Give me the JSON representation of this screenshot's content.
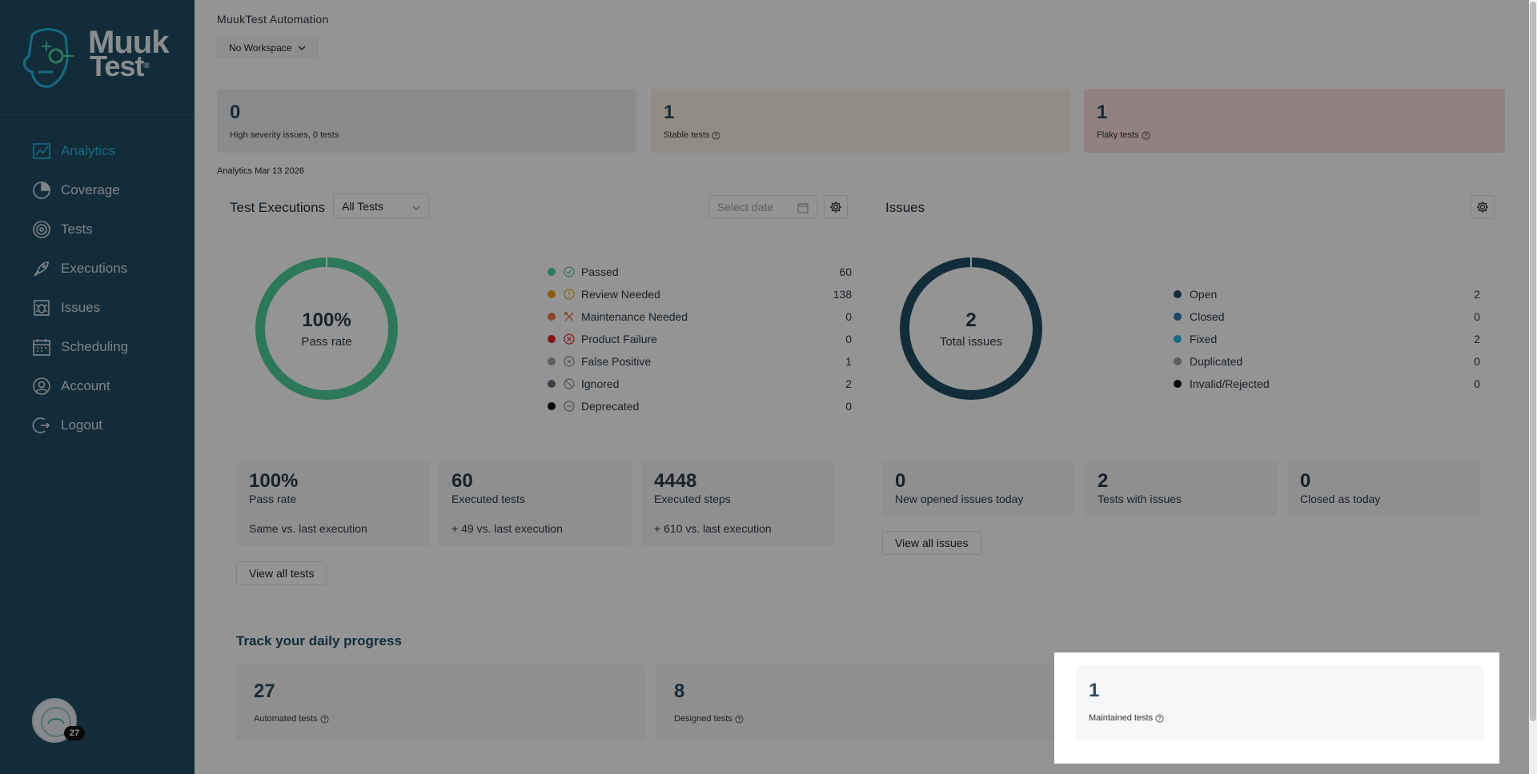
{
  "sidebar": {
    "logo": {
      "line1": "Muuk",
      "line2": "Test",
      "registered": "®"
    },
    "items": [
      {
        "label": "Analytics",
        "icon": "analytics-icon",
        "active": true
      },
      {
        "label": "Coverage",
        "icon": "coverage-icon",
        "active": false
      },
      {
        "label": "Tests",
        "icon": "tests-icon",
        "active": false
      },
      {
        "label": "Executions",
        "icon": "rocket-icon",
        "active": false
      },
      {
        "label": "Issues",
        "icon": "bug-icon",
        "active": false
      },
      {
        "label": "Scheduling",
        "icon": "calendar-icon",
        "active": false
      },
      {
        "label": "Account",
        "icon": "user-icon",
        "active": false
      },
      {
        "label": "Logout",
        "icon": "logout-icon",
        "active": false
      }
    ],
    "avatar_badge": "27"
  },
  "header": {
    "project_name": "MuukTest Automation",
    "workspace": "No Workspace"
  },
  "summary_cards": [
    {
      "number": "0",
      "label": "High severity issues, 0 tests",
      "color": "#eef0f3"
    },
    {
      "number": "1",
      "label": "Stable tests",
      "color": "#fbf3e2"
    },
    {
      "number": "1",
      "label": "Flaky tests",
      "color": "#fadfe2"
    }
  ],
  "analytics_date": "Analytics Mar 13 2026",
  "executions": {
    "title": "Test Executions",
    "filter": "All Tests",
    "date_placeholder": "Select date",
    "donut": {
      "value": "100%",
      "caption": "Pass rate",
      "percent": 100,
      "color": "#4ecf9c"
    },
    "legend": [
      {
        "label": "Passed",
        "value": "60",
        "color": "#4ecf9c",
        "icon": "check-circle-icon"
      },
      {
        "label": "Review Needed",
        "value": "138",
        "color": "#f2a31b",
        "icon": "clock-icon"
      },
      {
        "label": "Maintenance Needed",
        "value": "0",
        "color": "#f07b4f",
        "icon": "tools-icon"
      },
      {
        "label": "Product Failure",
        "value": "0",
        "color": "#e2262c",
        "icon": "x-circle-icon"
      },
      {
        "label": "False Positive",
        "value": "1",
        "color": "#a3a3a3",
        "icon": "false-positive-icon"
      },
      {
        "label": "Ignored",
        "value": "2",
        "color": "#5f6f7e",
        "icon": "ban-icon"
      },
      {
        "label": "Deprecated",
        "value": "0",
        "color": "#111111",
        "icon": "deprecated-icon"
      }
    ],
    "metrics": [
      {
        "number": "100%",
        "label": "Pass rate",
        "sub": "Same vs. last execution"
      },
      {
        "number": "60",
        "label": "Executed tests",
        "sub": "+ 49 vs. last execution"
      },
      {
        "number": "4448",
        "label": "Executed steps",
        "sub": "+ 610 vs. last execution"
      }
    ],
    "view_all": "View all tests"
  },
  "issues": {
    "title": "Issues",
    "donut": {
      "value": "2",
      "caption": "Total issues",
      "color": "#1f4e63"
    },
    "legend": [
      {
        "label": "Open",
        "value": "2",
        "color": "#1f4e63"
      },
      {
        "label": "Closed",
        "value": "0",
        "color": "#2d79b8"
      },
      {
        "label": "Fixed",
        "value": "2",
        "color": "#2bb6e6"
      },
      {
        "label": "Duplicated",
        "value": "0",
        "color": "#a3a3a3"
      },
      {
        "label": "Invalid/Rejected",
        "value": "0",
        "color": "#111111"
      }
    ],
    "metrics": [
      {
        "number": "0",
        "label": "New opened issues today"
      },
      {
        "number": "2",
        "label": "Tests with issues"
      },
      {
        "number": "0",
        "label": "Closed as today"
      }
    ],
    "view_all": "View all issues"
  },
  "track": {
    "title": "Track your daily progress",
    "cards": [
      {
        "number": "27",
        "label": "Automated tests"
      },
      {
        "number": "8",
        "label": "Designed tests"
      },
      {
        "number": "1",
        "label": "Maintained tests"
      }
    ]
  }
}
